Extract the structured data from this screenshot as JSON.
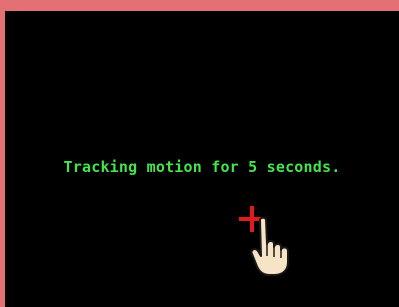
{
  "screen": {
    "status_message": "Tracking motion for 5 seconds."
  },
  "colors": {
    "frame_border": "#e46f74",
    "screen_background": "#000000",
    "text": "#45e34c",
    "crosshair": "#e11b1b",
    "hand_fill": "#f7e4c6"
  },
  "icons": {
    "crosshair": "crosshair-icon",
    "pointer": "pointing-hand-icon"
  }
}
